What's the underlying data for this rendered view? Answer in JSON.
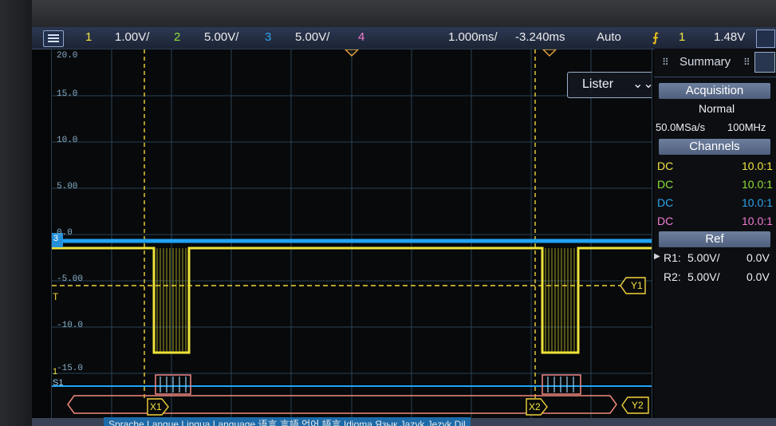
{
  "topbar": {
    "ch1": {
      "num": "1",
      "scale": "1.00V/"
    },
    "ch2": {
      "num": "2",
      "scale": "5.00V/"
    },
    "ch3": {
      "num": "3",
      "scale": "5.00V/"
    },
    "ch4": {
      "num": "4"
    },
    "timebase": "1.000ms/",
    "delay": "-3.240ms",
    "trigger_mode": "Auto",
    "trigger_source": "1",
    "trigger_level": "1.48V"
  },
  "waveform": {
    "y_labels": [
      "20.0",
      "15.0",
      "10.0",
      "5.00",
      "0.0",
      "-5.00",
      "-10.0",
      "-15.0"
    ],
    "lister_label": "Lister",
    "cursor_labels": {
      "x1": "X1",
      "x2": "X2",
      "y1": "Y1",
      "y2": "Y2"
    },
    "markers": {
      "ch3": "3",
      "trigger": "T",
      "ch1": "1",
      "s1": "S1"
    }
  },
  "panel": {
    "tab_label": "Summary",
    "acquisition": {
      "header": "Acquisition",
      "mode": "Normal",
      "sample_rate": "50.0MSa/s",
      "bandwidth": "100MHz"
    },
    "channels": {
      "header": "Channels",
      "rows": [
        {
          "coupling": "DC",
          "probe": "10.0:1",
          "color": "#f2e341"
        },
        {
          "coupling": "DC",
          "probe": "10.0:1",
          "color": "#8fe036"
        },
        {
          "coupling": "DC",
          "probe": "10.0:1",
          "color": "#2ea4ee"
        },
        {
          "coupling": "DC",
          "probe": "10.0:1",
          "color": "#f27bd3"
        }
      ]
    },
    "ref": {
      "header": "Ref",
      "rows": [
        {
          "name": "R1:",
          "scale": "5.00V/",
          "offset": "0.0V"
        },
        {
          "name": "R2:",
          "scale": "5.00V/",
          "offset": "0.0V"
        }
      ]
    }
  },
  "languages": "Sprache  Langue  Lingua  Language  语言  言語  언어  語言  Idioma  Язык  Jazyk  Język  Dil"
}
